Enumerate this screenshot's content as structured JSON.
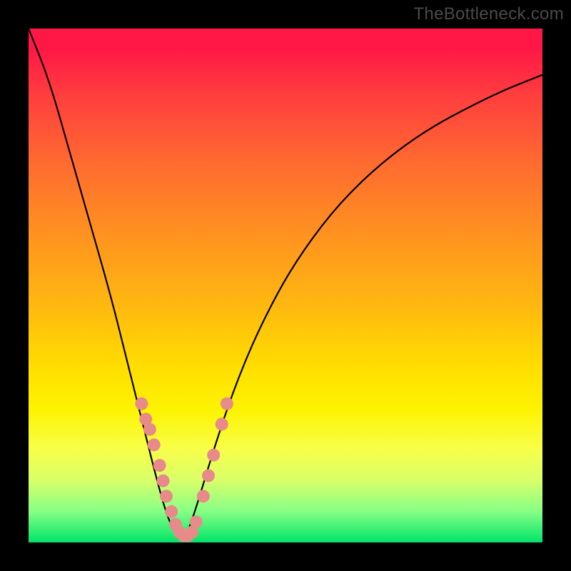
{
  "watermark": "TheBottleneck.com",
  "colors": {
    "curve_stroke": "#000000",
    "marker_fill": "#e98a8a",
    "marker_stroke": "#c77272"
  },
  "chart_data": {
    "type": "line",
    "title": "",
    "xlabel": "",
    "ylabel": "",
    "xlim": [
      0,
      100
    ],
    "ylim": [
      0,
      100
    ],
    "series": [
      {
        "name": "bottleneck-curve",
        "x": [
          0,
          4,
          8,
          12,
          16,
          19,
          22,
          25,
          27,
          28.5,
          30,
          31,
          33,
          36,
          40,
          45,
          52,
          62,
          75,
          90,
          100
        ],
        "y": [
          100,
          90,
          76,
          62,
          48,
          36,
          24,
          12,
          5,
          2,
          0.5,
          2,
          8,
          18,
          30,
          42,
          55,
          68,
          79,
          87,
          91
        ]
      }
    ],
    "markers": {
      "name": "highlighted-points",
      "points": [
        {
          "x": 22.0,
          "y": 27
        },
        {
          "x": 22.8,
          "y": 24
        },
        {
          "x": 23.6,
          "y": 22
        },
        {
          "x": 24.4,
          "y": 19
        },
        {
          "x": 25.5,
          "y": 15
        },
        {
          "x": 26.2,
          "y": 12
        },
        {
          "x": 26.8,
          "y": 9
        },
        {
          "x": 27.8,
          "y": 6
        },
        {
          "x": 28.6,
          "y": 3.5
        },
        {
          "x": 29.4,
          "y": 2
        },
        {
          "x": 30.2,
          "y": 1.3
        },
        {
          "x": 31.0,
          "y": 1.3
        },
        {
          "x": 31.8,
          "y": 2
        },
        {
          "x": 32.6,
          "y": 4
        },
        {
          "x": 34.0,
          "y": 9
        },
        {
          "x": 35.0,
          "y": 13
        },
        {
          "x": 36.0,
          "y": 17
        },
        {
          "x": 37.6,
          "y": 23
        },
        {
          "x": 38.6,
          "y": 27
        }
      ]
    }
  }
}
